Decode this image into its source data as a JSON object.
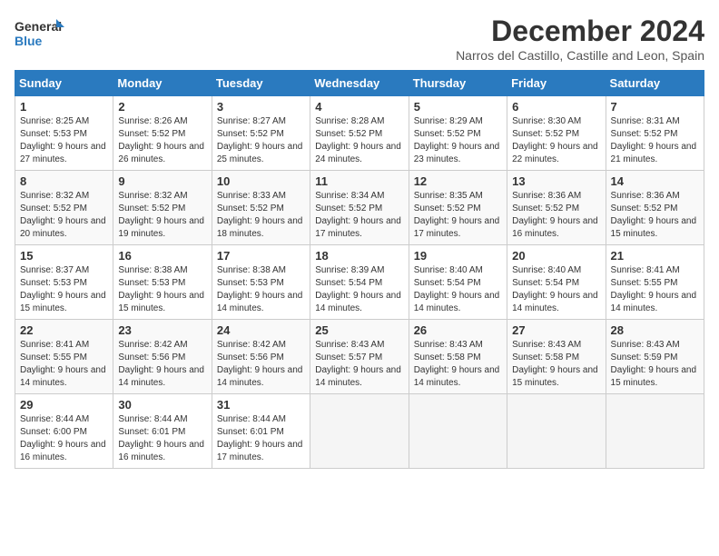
{
  "logo": {
    "line1": "General",
    "line2": "Blue"
  },
  "title": "December 2024",
  "location": "Narros del Castillo, Castille and Leon, Spain",
  "days_of_week": [
    "Sunday",
    "Monday",
    "Tuesday",
    "Wednesday",
    "Thursday",
    "Friday",
    "Saturday"
  ],
  "weeks": [
    [
      {
        "day": "1",
        "sunrise": "8:25 AM",
        "sunset": "5:53 PM",
        "daylight": "9 hours and 27 minutes."
      },
      {
        "day": "2",
        "sunrise": "8:26 AM",
        "sunset": "5:52 PM",
        "daylight": "9 hours and 26 minutes."
      },
      {
        "day": "3",
        "sunrise": "8:27 AM",
        "sunset": "5:52 PM",
        "daylight": "9 hours and 25 minutes."
      },
      {
        "day": "4",
        "sunrise": "8:28 AM",
        "sunset": "5:52 PM",
        "daylight": "9 hours and 24 minutes."
      },
      {
        "day": "5",
        "sunrise": "8:29 AM",
        "sunset": "5:52 PM",
        "daylight": "9 hours and 23 minutes."
      },
      {
        "day": "6",
        "sunrise": "8:30 AM",
        "sunset": "5:52 PM",
        "daylight": "9 hours and 22 minutes."
      },
      {
        "day": "7",
        "sunrise": "8:31 AM",
        "sunset": "5:52 PM",
        "daylight": "9 hours and 21 minutes."
      }
    ],
    [
      {
        "day": "8",
        "sunrise": "8:32 AM",
        "sunset": "5:52 PM",
        "daylight": "9 hours and 20 minutes."
      },
      {
        "day": "9",
        "sunrise": "8:32 AM",
        "sunset": "5:52 PM",
        "daylight": "9 hours and 19 minutes."
      },
      {
        "day": "10",
        "sunrise": "8:33 AM",
        "sunset": "5:52 PM",
        "daylight": "9 hours and 18 minutes."
      },
      {
        "day": "11",
        "sunrise": "8:34 AM",
        "sunset": "5:52 PM",
        "daylight": "9 hours and 17 minutes."
      },
      {
        "day": "12",
        "sunrise": "8:35 AM",
        "sunset": "5:52 PM",
        "daylight": "9 hours and 17 minutes."
      },
      {
        "day": "13",
        "sunrise": "8:36 AM",
        "sunset": "5:52 PM",
        "daylight": "9 hours and 16 minutes."
      },
      {
        "day": "14",
        "sunrise": "8:36 AM",
        "sunset": "5:52 PM",
        "daylight": "9 hours and 15 minutes."
      }
    ],
    [
      {
        "day": "15",
        "sunrise": "8:37 AM",
        "sunset": "5:53 PM",
        "daylight": "9 hours and 15 minutes."
      },
      {
        "day": "16",
        "sunrise": "8:38 AM",
        "sunset": "5:53 PM",
        "daylight": "9 hours and 15 minutes."
      },
      {
        "day": "17",
        "sunrise": "8:38 AM",
        "sunset": "5:53 PM",
        "daylight": "9 hours and 14 minutes."
      },
      {
        "day": "18",
        "sunrise": "8:39 AM",
        "sunset": "5:54 PM",
        "daylight": "9 hours and 14 minutes."
      },
      {
        "day": "19",
        "sunrise": "8:40 AM",
        "sunset": "5:54 PM",
        "daylight": "9 hours and 14 minutes."
      },
      {
        "day": "20",
        "sunrise": "8:40 AM",
        "sunset": "5:54 PM",
        "daylight": "9 hours and 14 minutes."
      },
      {
        "day": "21",
        "sunrise": "8:41 AM",
        "sunset": "5:55 PM",
        "daylight": "9 hours and 14 minutes."
      }
    ],
    [
      {
        "day": "22",
        "sunrise": "8:41 AM",
        "sunset": "5:55 PM",
        "daylight": "9 hours and 14 minutes."
      },
      {
        "day": "23",
        "sunrise": "8:42 AM",
        "sunset": "5:56 PM",
        "daylight": "9 hours and 14 minutes."
      },
      {
        "day": "24",
        "sunrise": "8:42 AM",
        "sunset": "5:56 PM",
        "daylight": "9 hours and 14 minutes."
      },
      {
        "day": "25",
        "sunrise": "8:43 AM",
        "sunset": "5:57 PM",
        "daylight": "9 hours and 14 minutes."
      },
      {
        "day": "26",
        "sunrise": "8:43 AM",
        "sunset": "5:58 PM",
        "daylight": "9 hours and 14 minutes."
      },
      {
        "day": "27",
        "sunrise": "8:43 AM",
        "sunset": "5:58 PM",
        "daylight": "9 hours and 15 minutes."
      },
      {
        "day": "28",
        "sunrise": "8:43 AM",
        "sunset": "5:59 PM",
        "daylight": "9 hours and 15 minutes."
      }
    ],
    [
      {
        "day": "29",
        "sunrise": "8:44 AM",
        "sunset": "6:00 PM",
        "daylight": "9 hours and 16 minutes."
      },
      {
        "day": "30",
        "sunrise": "8:44 AM",
        "sunset": "6:01 PM",
        "daylight": "9 hours and 16 minutes."
      },
      {
        "day": "31",
        "sunrise": "8:44 AM",
        "sunset": "6:01 PM",
        "daylight": "9 hours and 17 minutes."
      },
      null,
      null,
      null,
      null
    ]
  ]
}
